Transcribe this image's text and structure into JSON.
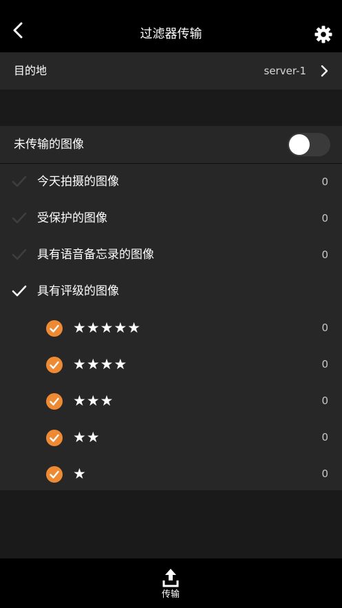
{
  "header": {
    "title": "过滤器传输",
    "back_icon": "chevron-left-icon",
    "settings_icon": "gear-icon"
  },
  "destination": {
    "label": "目的地",
    "value": "server-1"
  },
  "untransferred": {
    "label": "未传输的图像",
    "enabled": false
  },
  "filters": [
    {
      "label": "今天拍摄的图像",
      "count": "0",
      "checked": false
    },
    {
      "label": "受保护的图像",
      "count": "0",
      "checked": false
    },
    {
      "label": "具有语音备忘录的图像",
      "count": "0",
      "checked": false
    },
    {
      "label": "具有评级的图像",
      "checked": true
    }
  ],
  "ratings": [
    {
      "stars": "★★★★★",
      "count": "0",
      "checked": true
    },
    {
      "stars": "★★★★",
      "count": "0",
      "checked": true
    },
    {
      "stars": "★★★",
      "count": "0",
      "checked": true
    },
    {
      "stars": "★★",
      "count": "0",
      "checked": true
    },
    {
      "stars": "★",
      "count": "0",
      "checked": true
    }
  ],
  "bottom_bar": {
    "transfer_label": "传输",
    "transfer_icon": "upload-icon"
  },
  "colors": {
    "accent_orange": "#ef8a34",
    "row_background": "#272727",
    "bar_background": "#000000"
  }
}
